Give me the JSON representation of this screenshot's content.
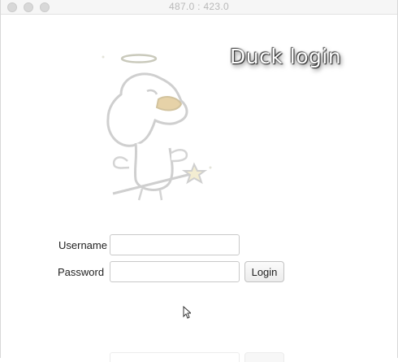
{
  "window": {
    "title": "487.0 : 423.0"
  },
  "header": {
    "title": "Duck login"
  },
  "illustration": {
    "icon": "angel-duck-illustration"
  },
  "form": {
    "username_label": "Username",
    "username_value": "",
    "password_label": "Password",
    "password_value": "",
    "login_label": "Login"
  }
}
